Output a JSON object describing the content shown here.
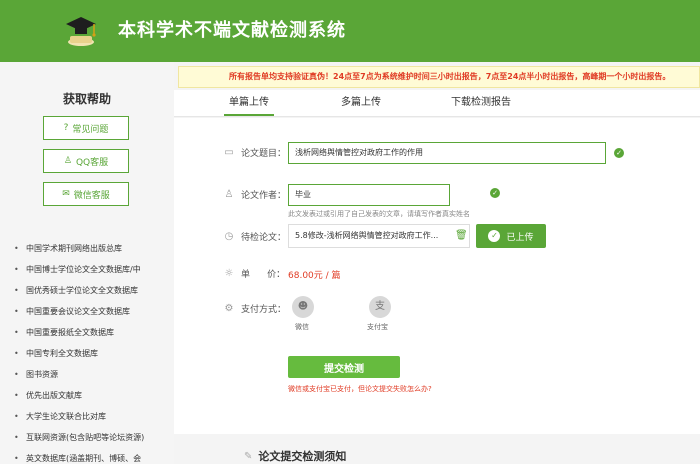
{
  "header": {
    "title": "本科学术不端文献检测系统",
    "logo_icon": "graduation-cap-icon",
    "bg_color": "#5aa637"
  },
  "sidebar": {
    "help_title": "获取帮助",
    "help_buttons": [
      {
        "label": "常见问题",
        "icon": "question-circle-icon"
      },
      {
        "label": "QQ客服",
        "icon": "qq-icon"
      },
      {
        "label": "微信客服",
        "icon": "wechat-icon"
      }
    ],
    "databases": [
      "中国学术期刊网络出版总库",
      "中国博士学位论文全文数据库/中",
      "国优秀硕士学位论文全文数据库",
      "中国重要会议论文全文数据库",
      "中国重要报纸全文数据库",
      "中国专利全文数据库",
      "图书资源",
      "优先出版文献库",
      "大学生论文联合比对库",
      "互联网资源(包含贴吧等论坛资源)",
      "英文数据库(涵盖期刊、博硕、会"
    ]
  },
  "main": {
    "notice": "所有报告单均支持验证真伪！24点至7点为系统维护时间三小时出报告，7点至24点半小时出报告，高峰期一个小时出报告。",
    "tabs": [
      {
        "label": "单篇上传",
        "active": true
      },
      {
        "label": "多篇上传",
        "active": false
      },
      {
        "label": "下载检测报告",
        "active": false
      }
    ],
    "form": {
      "title_label": "论文题目：",
      "title_value": "浅析网络舆情管控对政府工作的作用",
      "author_label": "论文作者：",
      "author_value": "毕业",
      "author_hint": "此文发表过或引用了自己发表的文章，请填写作者真实姓名",
      "file_label": "待检论文：",
      "file_value": "5.8修改-浅析网络舆情管控对政府工作...",
      "uploaded_label": "已上传",
      "price_label": "单      价：",
      "price_value": "68.00元 / 篇",
      "pay_label": "支付方式：",
      "pay_methods": [
        {
          "label": "微信",
          "icon": "wechat-pay-icon"
        },
        {
          "label": "支付宝",
          "icon": "alipay-icon"
        }
      ],
      "submit_label": "提交检测",
      "paid_link": "微信或支付宝已支付，但论文提交失败怎么办?"
    },
    "bottom_title": "论文提交检测须知",
    "accent_color": "#5aa637",
    "notice_color": "#e03b24"
  }
}
